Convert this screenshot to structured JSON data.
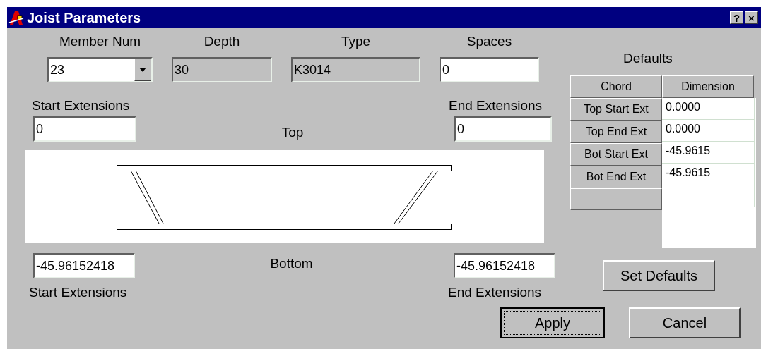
{
  "window": {
    "title": "Joist Parameters",
    "controls": [
      "?",
      "×"
    ]
  },
  "fields": [
    {
      "label": "Member Num",
      "value": "23",
      "kind": "dropdown",
      "disabled": false
    },
    {
      "label": "Depth",
      "value": "30",
      "kind": "text",
      "disabled": true
    },
    {
      "label": "Type",
      "value": "K3014",
      "kind": "text",
      "disabled": true
    },
    {
      "label": "Spaces",
      "value": "0",
      "kind": "text",
      "disabled": false
    }
  ],
  "top": {
    "label": "Top",
    "start": {
      "label": "Start Extensions",
      "value": "0"
    },
    "end": {
      "label": "End Extensions",
      "value": "0"
    }
  },
  "bottom": {
    "label": "Bottom",
    "start": {
      "label": "Start Extensions",
      "value": "-45.96152418"
    },
    "end": {
      "label": "End Extensions",
      "value": "-45.96152418"
    }
  },
  "defaults": {
    "title": "Defaults",
    "columns": [
      "Chord",
      "Dimension"
    ],
    "rows": [
      {
        "chord": "Top Start Ext",
        "dimension": "0.0000"
      },
      {
        "chord": "Top End Ext",
        "dimension": "0.0000"
      },
      {
        "chord": "Bot Start Ext",
        "dimension": "-45.9615"
      },
      {
        "chord": "Bot End Ext",
        "dimension": "-45.9615"
      }
    ],
    "button": {
      "label": "Set Defaults"
    }
  },
  "buttons": [
    {
      "label": "Apply",
      "focused": true
    },
    {
      "label": "Cancel",
      "focused": false
    }
  ]
}
